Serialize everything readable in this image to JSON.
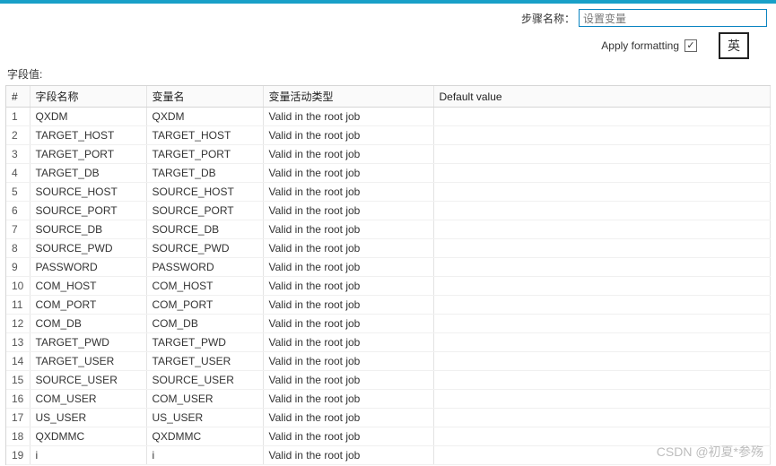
{
  "header": {
    "step_label": "步骤名称：",
    "step_value": "设置变量",
    "apply_label": "Apply formatting",
    "apply_checked": "✓",
    "ime_badge": "英"
  },
  "section": {
    "fields_label": "字段值:"
  },
  "table": {
    "columns": {
      "idx": "#",
      "field_name": "字段名称",
      "var_name": "变量名",
      "activity_type": "变量活动类型",
      "default_value": "Default value"
    },
    "rows": [
      {
        "n": "1",
        "field": "QXDM",
        "var": "QXDM",
        "type": "Valid in the root job",
        "def": ""
      },
      {
        "n": "2",
        "field": "TARGET_HOST",
        "var": "TARGET_HOST",
        "type": "Valid in the root job",
        "def": ""
      },
      {
        "n": "3",
        "field": "TARGET_PORT",
        "var": "TARGET_PORT",
        "type": "Valid in the root job",
        "def": ""
      },
      {
        "n": "4",
        "field": "TARGET_DB",
        "var": "TARGET_DB",
        "type": "Valid in the root job",
        "def": ""
      },
      {
        "n": "5",
        "field": "SOURCE_HOST",
        "var": "SOURCE_HOST",
        "type": "Valid in the root job",
        "def": ""
      },
      {
        "n": "6",
        "field": "SOURCE_PORT",
        "var": "SOURCE_PORT",
        "type": "Valid in the root job",
        "def": ""
      },
      {
        "n": "7",
        "field": "SOURCE_DB",
        "var": "SOURCE_DB",
        "type": "Valid in the root job",
        "def": ""
      },
      {
        "n": "8",
        "field": "SOURCE_PWD",
        "var": "SOURCE_PWD",
        "type": "Valid in the root job",
        "def": ""
      },
      {
        "n": "9",
        "field": "PASSWORD",
        "var": "PASSWORD",
        "type": "Valid in the root job",
        "def": ""
      },
      {
        "n": "10",
        "field": "COM_HOST",
        "var": "COM_HOST",
        "type": "Valid in the root job",
        "def": ""
      },
      {
        "n": "11",
        "field": "COM_PORT",
        "var": "COM_PORT",
        "type": "Valid in the root job",
        "def": ""
      },
      {
        "n": "12",
        "field": "COM_DB",
        "var": "COM_DB",
        "type": "Valid in the root job",
        "def": ""
      },
      {
        "n": "13",
        "field": "TARGET_PWD",
        "var": "TARGET_PWD",
        "type": "Valid in the root job",
        "def": ""
      },
      {
        "n": "14",
        "field": "TARGET_USER",
        "var": "TARGET_USER",
        "type": "Valid in the root job",
        "def": ""
      },
      {
        "n": "15",
        "field": "SOURCE_USER",
        "var": "SOURCE_USER",
        "type": "Valid in the root job",
        "def": ""
      },
      {
        "n": "16",
        "field": "COM_USER",
        "var": "COM_USER",
        "type": "Valid in the root job",
        "def": ""
      },
      {
        "n": "17",
        "field": "US_USER",
        "var": "US_USER",
        "type": "Valid in the root job",
        "def": ""
      },
      {
        "n": "18",
        "field": "QXDMMC",
        "var": "QXDMMC",
        "type": "Valid in the root job",
        "def": ""
      },
      {
        "n": "19",
        "field": "i",
        "var": "i",
        "type": "Valid in the root job",
        "def": ""
      }
    ]
  },
  "watermark": "CSDN @初夏*参殇"
}
